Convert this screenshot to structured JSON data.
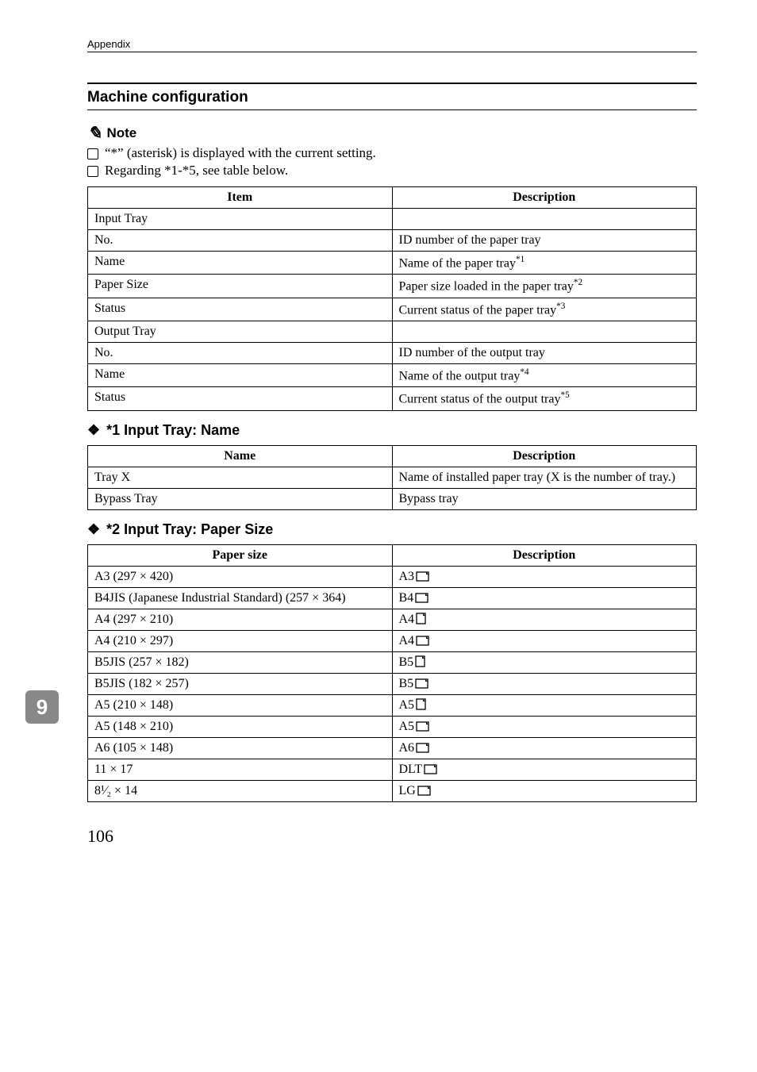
{
  "header": {
    "label": "Appendix"
  },
  "section": {
    "title": "Machine configuration"
  },
  "note": {
    "heading": "Note",
    "items": [
      "“*” (asterisk) is displayed with the current setting.",
      "Regarding *1-*5, see table below."
    ]
  },
  "main_table": {
    "head": {
      "item": "Item",
      "desc": "Description"
    },
    "groups": [
      {
        "title": "Input Tray",
        "rows": [
          {
            "item": "No.",
            "desc": "ID number of the paper tray",
            "sup": ""
          },
          {
            "item": "Name",
            "desc": "Name of the paper tray",
            "sup": "*1"
          },
          {
            "item": "Paper Size",
            "desc": "Paper size loaded in the paper tray",
            "sup": "*2"
          },
          {
            "item": "Status",
            "desc": "Current status of the paper tray",
            "sup": "*3"
          }
        ]
      },
      {
        "title": "Output Tray",
        "rows": [
          {
            "item": "No.",
            "desc": "ID number of the output tray",
            "sup": ""
          },
          {
            "item": "Name",
            "desc": "Name of the output tray",
            "sup": "*4"
          },
          {
            "item": "Status",
            "desc": "Current status of the output tray",
            "sup": "*5"
          }
        ]
      }
    ]
  },
  "sub1": {
    "title": "*1 Input Tray: Name",
    "head": {
      "name": "Name",
      "desc": "Description"
    },
    "rows": [
      {
        "name": "Tray X",
        "desc": "Name of installed paper tray (X is the number of tray.)"
      },
      {
        "name": "Bypass Tray",
        "desc": "Bypass tray"
      }
    ]
  },
  "sub2": {
    "title": "*2 Input Tray: Paper Size",
    "head": {
      "size": "Paper size",
      "desc": "Description"
    },
    "rows": [
      {
        "size": "A3 (297 × 420)",
        "code": "A3",
        "orient": "landscape"
      },
      {
        "size": "B4JIS (Japanese Industrial Standard) (257 × 364)",
        "code": "B4",
        "orient": "landscape"
      },
      {
        "size": "A4 (297 × 210)",
        "code": "A4",
        "orient": "portrait"
      },
      {
        "size": "A4 (210 × 297)",
        "code": "A4",
        "orient": "landscape"
      },
      {
        "size": "B5JIS (257 × 182)",
        "code": "B5",
        "orient": "portrait"
      },
      {
        "size": "B5JIS (182 × 257)",
        "code": "B5",
        "orient": "landscape"
      },
      {
        "size": "A5 (210 × 148)",
        "code": "A5",
        "orient": "portrait"
      },
      {
        "size": "A5 (148 × 210)",
        "code": "A5",
        "orient": "landscape"
      },
      {
        "size": "A6 (105 × 148)",
        "code": "A6",
        "orient": "landscape"
      },
      {
        "size": "11 × 17",
        "code": "DLT",
        "orient": "landscape"
      },
      {
        "size": "8¹⁄₂ × 14",
        "code": "LG",
        "orient": "landscape"
      }
    ]
  },
  "side_tab": {
    "number": "9"
  },
  "page_number": "106"
}
